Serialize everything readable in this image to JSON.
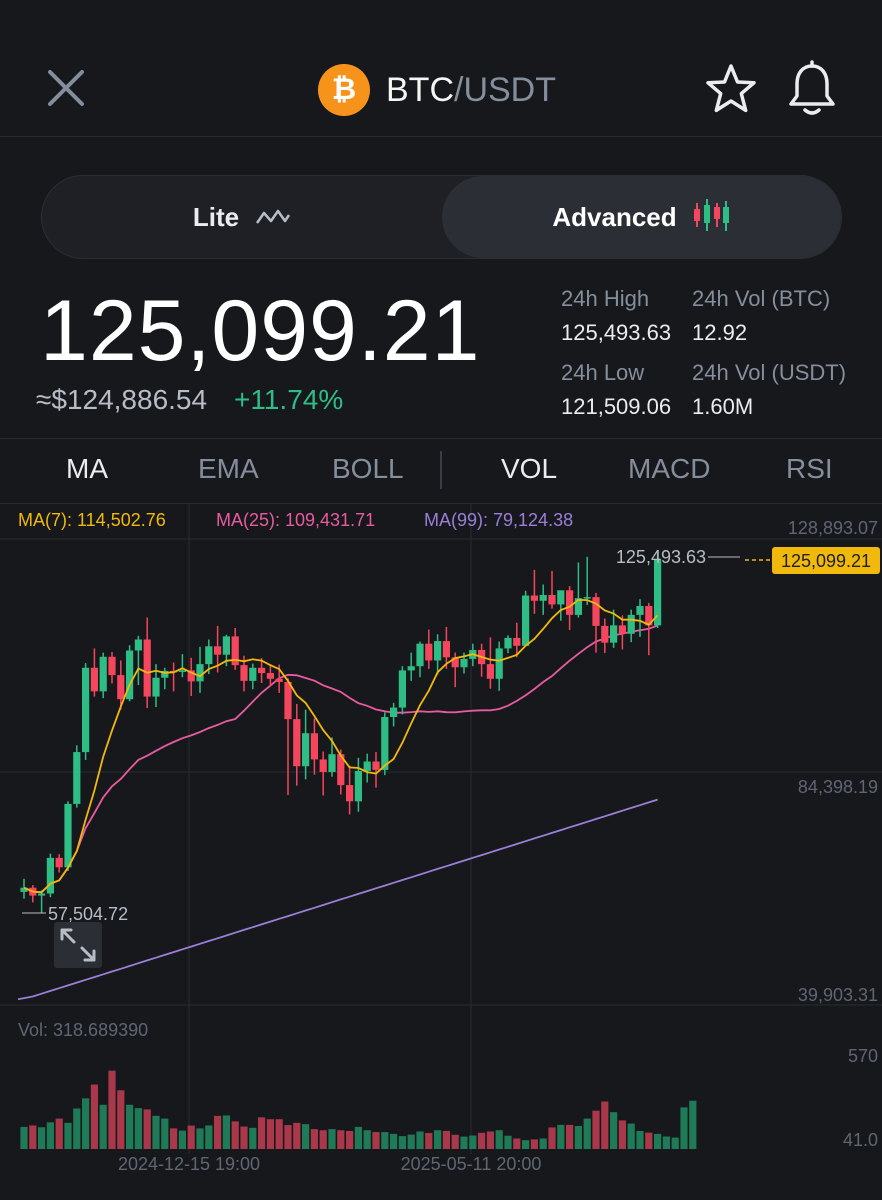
{
  "header": {
    "coin_symbol": "₿",
    "base": "BTC",
    "quote": "/USDT"
  },
  "toggle": {
    "lite_label": "Lite",
    "advanced_label": "Advanced",
    "active": "Advanced"
  },
  "price": {
    "last": "125,099.21",
    "usd_approx": "≈$124,886.54",
    "change": "+11.74%"
  },
  "stats": {
    "high_label": "24h High",
    "high_value": "125,493.63",
    "low_label": "24h Low",
    "low_value": "121,509.06",
    "vol_btc_label": "24h Vol (BTC)",
    "vol_btc_value": "12.92",
    "vol_usdt_label": "24h Vol (USDT)",
    "vol_usdt_value": "1.60M"
  },
  "indicator_tabs": {
    "ma": "MA",
    "ema": "EMA",
    "boll": "BOLL",
    "vol": "VOL",
    "macd": "MACD",
    "rsi": "RSI",
    "active_main": "MA",
    "active_sub": "VOL"
  },
  "chart_data": {
    "type": "candlestick",
    "ma_legend": {
      "ma7": "MA(7): 114,502.76",
      "ma25": "MA(25): 109,431.71",
      "ma99": "MA(99): 79,124.38"
    },
    "y_ticks": [
      "128,893.07",
      "84,398.19",
      "39,903.31"
    ],
    "ylim": [
      39903.31,
      128893.07
    ],
    "high_marker": "125,493.63",
    "low_marker": "57,504.72",
    "last_price_tag": "125,099.21",
    "x_ticks": [
      "2024-12-15 19:00",
      "2025-05-11 20:00"
    ],
    "volume": {
      "label": "Vol: 318.689390",
      "y_ticks": [
        "570",
        "41.0"
      ]
    },
    "candles": [
      [
        61500,
        64000,
        60200,
        62300
      ],
      [
        62300,
        62800,
        59500,
        60800
      ],
      [
        60800,
        61800,
        57500,
        61200
      ],
      [
        61200,
        68800,
        60500,
        68000
      ],
      [
        68000,
        68700,
        65200,
        66200
      ],
      [
        66200,
        78800,
        65500,
        78300
      ],
      [
        78300,
        89500,
        77600,
        88200
      ],
      [
        88200,
        105200,
        86700,
        104300
      ],
      [
        104300,
        108000,
        98800,
        99800
      ],
      [
        99800,
        107200,
        98500,
        106400
      ],
      [
        106400,
        107300,
        101300,
        102900
      ],
      [
        102900,
        105700,
        96300,
        98300
      ],
      [
        98300,
        108600,
        97900,
        107600
      ],
      [
        107600,
        110400,
        101000,
        109700
      ],
      [
        109700,
        113900,
        96600,
        98800
      ],
      [
        98800,
        105000,
        96800,
        102400
      ],
      [
        102400,
        104300,
        100200,
        103700
      ],
      [
        103700,
        105300,
        99800,
        103500
      ],
      [
        103500,
        106900,
        102500,
        103800
      ],
      [
        103800,
        106200,
        98900,
        101700
      ],
      [
        101700,
        108300,
        99500,
        105000
      ],
      [
        105000,
        109700,
        103100,
        108400
      ],
      [
        108400,
        112300,
        103400,
        106800
      ],
      [
        106800,
        110600,
        104600,
        110300
      ],
      [
        110300,
        111900,
        103900,
        104800
      ],
      [
        104800,
        106600,
        99800,
        101800
      ],
      [
        101800,
        105100,
        100200,
        104300
      ],
      [
        104300,
        106200,
        101400,
        103300
      ],
      [
        103300,
        105000,
        100800,
        102200
      ],
      [
        102200,
        104900,
        99500,
        101600
      ],
      [
        101600,
        102300,
        80000,
        94500
      ],
      [
        94500,
        97400,
        81800,
        85500
      ],
      [
        85500,
        96300,
        83000,
        91800
      ],
      [
        91800,
        94600,
        83900,
        86800
      ],
      [
        86800,
        88300,
        79900,
        84400
      ],
      [
        84400,
        91000,
        83500,
        87800
      ],
      [
        87800,
        88700,
        80100,
        81900
      ],
      [
        81900,
        85600,
        76300,
        78800
      ],
      [
        78800,
        87100,
        76800,
        84600
      ],
      [
        84600,
        87900,
        82400,
        86400
      ],
      [
        86400,
        88200,
        81400,
        84800
      ],
      [
        84800,
        95800,
        83800,
        94900
      ],
      [
        94900,
        97600,
        93100,
        96700
      ],
      [
        96700,
        104600,
        95400,
        103800
      ],
      [
        103800,
        107200,
        101800,
        104600
      ],
      [
        104600,
        109300,
        102500,
        108900
      ],
      [
        108900,
        111600,
        104100,
        105700
      ],
      [
        105700,
        110700,
        103000,
        109400
      ],
      [
        109400,
        112100,
        104100,
        106300
      ],
      [
        106300,
        107200,
        100600,
        104400
      ],
      [
        104400,
        107200,
        103200,
        106000
      ],
      [
        106000,
        108900,
        104600,
        107700
      ],
      [
        107700,
        108900,
        102600,
        105000
      ],
      [
        105000,
        110100,
        100300,
        102200
      ],
      [
        102200,
        109300,
        99900,
        108000
      ],
      [
        108000,
        110500,
        107100,
        110000
      ],
      [
        110000,
        112900,
        106300,
        108500
      ],
      [
        108500,
        119000,
        108400,
        118100
      ],
      [
        118100,
        123000,
        114600,
        117100
      ],
      [
        117100,
        120200,
        114400,
        118200
      ],
      [
        118200,
        122800,
        115600,
        116400
      ],
      [
        116400,
        118900,
        113300,
        119100
      ],
      [
        119100,
        119900,
        111500,
        114400
      ],
      [
        114400,
        124400,
        113900,
        117600
      ],
      [
        117600,
        125493.63,
        116300,
        117800
      ],
      [
        117800,
        118600,
        107200,
        112300
      ],
      [
        112300,
        113700,
        107100,
        109100
      ],
      [
        109100,
        115400,
        108100,
        112400
      ],
      [
        112400,
        114300,
        107800,
        110800
      ],
      [
        110800,
        115400,
        109200,
        114400
      ],
      [
        114400,
        117400,
        110200,
        116100
      ],
      [
        116100,
        116700,
        106700,
        112400
      ],
      [
        112400,
        126300,
        111900,
        125099.21
      ]
    ],
    "volumes": [
      120,
      128,
      118,
      145,
      165,
      142,
      220,
      275,
      350,
      240,
      425,
      318.69,
      240,
      222,
      215,
      180,
      165,
      112,
      100,
      127,
      112,
      128,
      180,
      182,
      150,
      122,
      115,
      172,
      162,
      162,
      130,
      142,
      135,
      108,
      102,
      108,
      102,
      98,
      120,
      102,
      92,
      92,
      82,
      70,
      78,
      95,
      87,
      102,
      98,
      77,
      67,
      73,
      88,
      95,
      102,
      72,
      57,
      48,
      52,
      57,
      117,
      131,
      131,
      125,
      165,
      208,
      258,
      200,
      155,
      138,
      98,
      89,
      82,
      68,
      62,
      226,
      262
    ]
  }
}
